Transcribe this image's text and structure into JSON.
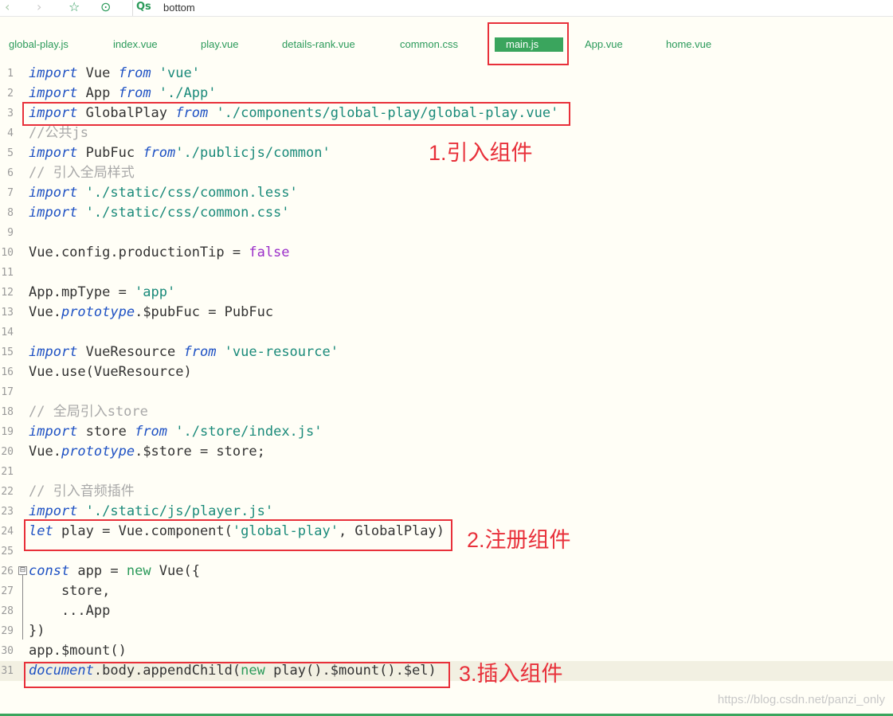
{
  "toolbar": {
    "back_icon": "‹",
    "forward_icon": "›",
    "star_icon": "☆",
    "run_icon": "⊙",
    "search_icon": "Qs",
    "search_value": "bottom"
  },
  "tabs": [
    "global-play.js",
    "index.vue",
    "play.vue",
    "details-rank.vue",
    "common.css",
    "main.js",
    "App.vue",
    "home.vue"
  ],
  "active_tab": "main.js",
  "colors": {
    "accent": "#3aa55d",
    "annotation": "#e8303a",
    "keyword": "#1f52c4",
    "string": "#1a8a7a",
    "comment": "#a8a8a8",
    "boolean": "#9b2fc9"
  },
  "line_numbers": [
    "1",
    "2",
    "3",
    "4",
    "5",
    "6",
    "7",
    "8",
    "9",
    "10",
    "11",
    "12",
    "13",
    "14",
    "15",
    "16",
    "17",
    "18",
    "19",
    "20",
    "21",
    "22",
    "23",
    "24",
    "25",
    "26",
    "27",
    "28",
    "29",
    "30",
    "31"
  ],
  "code": {
    "l1": [
      "import",
      " Vue ",
      "from",
      " 'vue'"
    ],
    "l2": [
      "import",
      " App ",
      "from",
      " './App'"
    ],
    "l3": [
      "import",
      " GlobalPlay ",
      "from",
      " './components/global-play/global-play.vue'"
    ],
    "l4": [
      "//公共js"
    ],
    "l5": [
      "import",
      " PubFuc ",
      "from",
      "'./publicjs/common'"
    ],
    "l6": [
      "// 引入全局样式"
    ],
    "l7": [
      "import",
      " './static/css/common.less'"
    ],
    "l8": [
      "import",
      " './static/css/common.css'"
    ],
    "l10": [
      "Vue.config.productionTip = ",
      "false"
    ],
    "l12": [
      "App.mpType = ",
      "'app'"
    ],
    "l13": [
      "Vue.",
      "prototype",
      ".$pubFuc = PubFuc"
    ],
    "l15": [
      "import",
      " VueResource ",
      "from",
      " 'vue-resource'"
    ],
    "l16": [
      "Vue.use(VueResource)"
    ],
    "l18": [
      "// 全局引入store"
    ],
    "l19": [
      "import",
      " store ",
      "from",
      " './store/index.js'"
    ],
    "l20": [
      "Vue.",
      "prototype",
      ".$store = store;"
    ],
    "l22": [
      "// 引入音频插件"
    ],
    "l23": [
      "import",
      " './static/js/player.js'"
    ],
    "l24": [
      "let",
      " play = Vue.component(",
      "'global-play'",
      ", GlobalPlay)"
    ],
    "l26": [
      "const",
      " app = ",
      "new",
      " Vue({"
    ],
    "l27": [
      "    store,"
    ],
    "l28": [
      "    ...App"
    ],
    "l29": [
      "})"
    ],
    "l30": [
      "app.$mount()"
    ],
    "l31": [
      "document",
      ".body.appendChild(",
      "new",
      " play().$mount().$el)"
    ]
  },
  "fold_marker": "⊟",
  "annotations": [
    "1.引入组件",
    "2.注册组件",
    "3.插入组件"
  ],
  "watermark": "https://blog.csdn.net/panzi_only"
}
